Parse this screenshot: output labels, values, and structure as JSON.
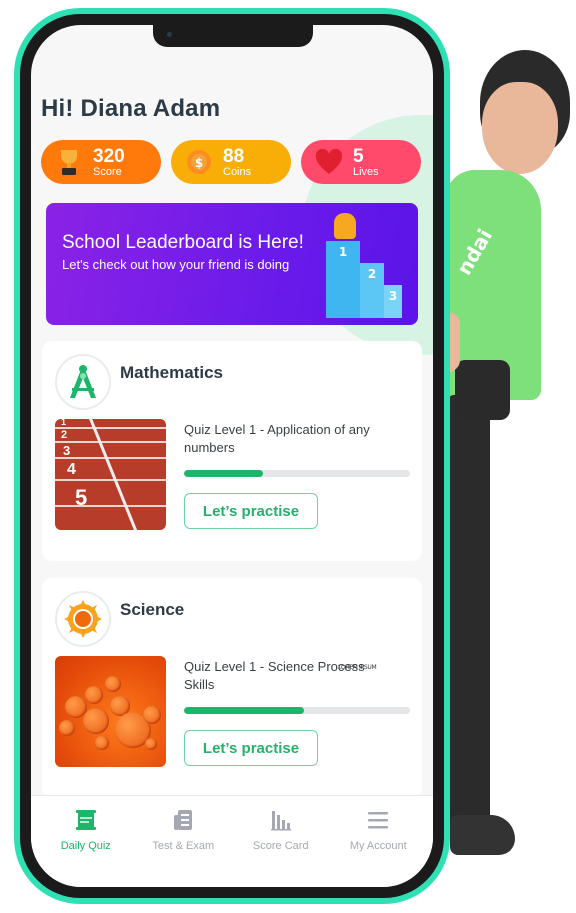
{
  "greeting": "Hi! Diana Adam",
  "stats": [
    {
      "value": "320",
      "label": "Score",
      "icon": "trophy-icon",
      "color": "#ff7a0a"
    },
    {
      "value": "88",
      "label": "Coins",
      "icon": "coin-icon",
      "color": "#f9ae07"
    },
    {
      "value": "5",
      "label": "Lives",
      "icon": "heart-icon",
      "color": "#ff4a6b"
    }
  ],
  "banner": {
    "title": "School Leaderboard is Here!",
    "subtitle": "Let's check out how your friend is doing",
    "podium": [
      "1",
      "2",
      "3"
    ]
  },
  "subjects": [
    {
      "name": "Mathematics",
      "icon": "compass-icon",
      "quiz_title": "Quiz Level 1 - Application of any numbers",
      "progress_percent": 35,
      "button_label": "Let’s practise",
      "lanes": [
        "1",
        "2",
        "3",
        "4",
        "5"
      ]
    },
    {
      "name": "Science",
      "icon": "sun-icon",
      "quiz_title": "Quiz Level 1 - Science Process Skills",
      "progress_percent": 53,
      "button_label": "Let’s practise",
      "tag": "LOREM IPSUM"
    }
  ],
  "nav": [
    {
      "label": "Daily Quiz",
      "icon": "quiz-board-icon",
      "active": true
    },
    {
      "label": "Test & Exam",
      "icon": "exam-paper-icon",
      "active": false
    },
    {
      "label": "Score Card",
      "icon": "bar-chart-icon",
      "active": false
    },
    {
      "label": "My Account",
      "icon": "menu-icon",
      "active": false
    }
  ],
  "colors": {
    "accent_green": "#1cb66a",
    "phone_frame": "#2fe0b5",
    "banner_purple": "#7a1ee8",
    "text_dark": "#2d3b48",
    "nav_inactive": "#a5a8b3"
  },
  "shirt_text": "ndai"
}
